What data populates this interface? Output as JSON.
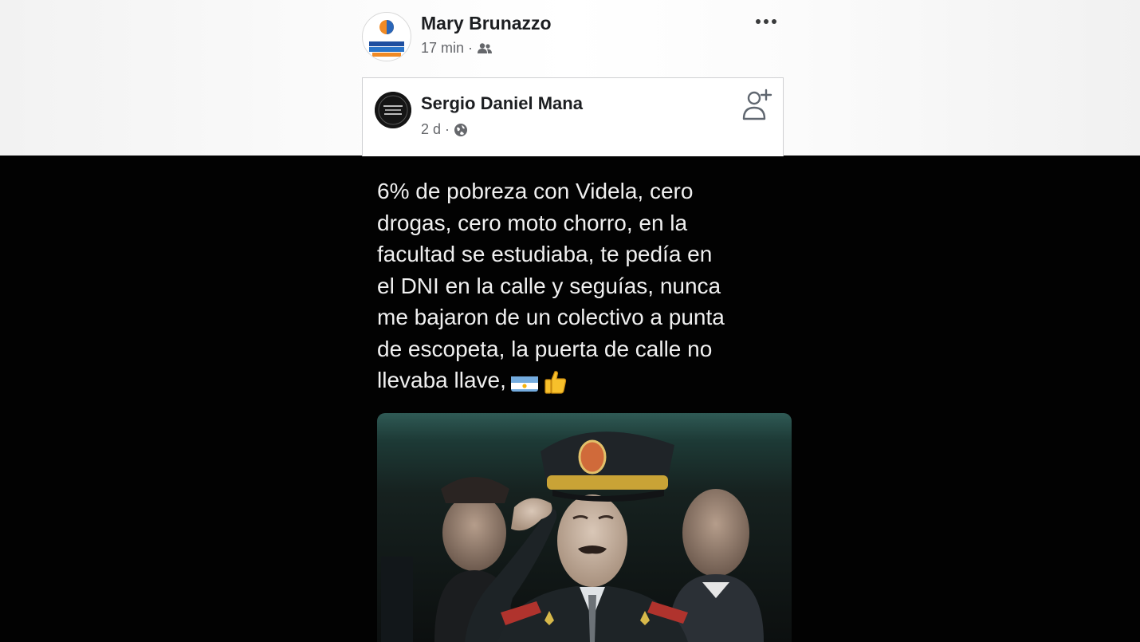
{
  "post": {
    "author": "Mary Brunazzo",
    "time": "17 min",
    "separator": "·",
    "audience_icon": "friends-icon",
    "avatar_text": "FRENTE PROGRESISTA"
  },
  "shared_post": {
    "author": "Sergio Daniel Mana",
    "time": "2 d",
    "separator": "·",
    "audience_icon": "globe-icon"
  },
  "content": {
    "lines": [
      "6% de pobreza con Videla, cero",
      "drogas, cero moto chorro, en la",
      "facultad se estudiaba, te pedía en",
      "el DNI en la calle y seguías, nunca",
      "me bajaron de un colectivo a punta",
      "de escopeta, la puerta de calle no",
      "llevaba llave,"
    ],
    "emojis": [
      "argentina-flag-icon",
      "thumbs-up-icon"
    ]
  },
  "colors": {
    "name": "#1c1e21",
    "meta": "#65676b",
    "dark_bg": "#020202",
    "post_text": "#f0f0f0"
  }
}
